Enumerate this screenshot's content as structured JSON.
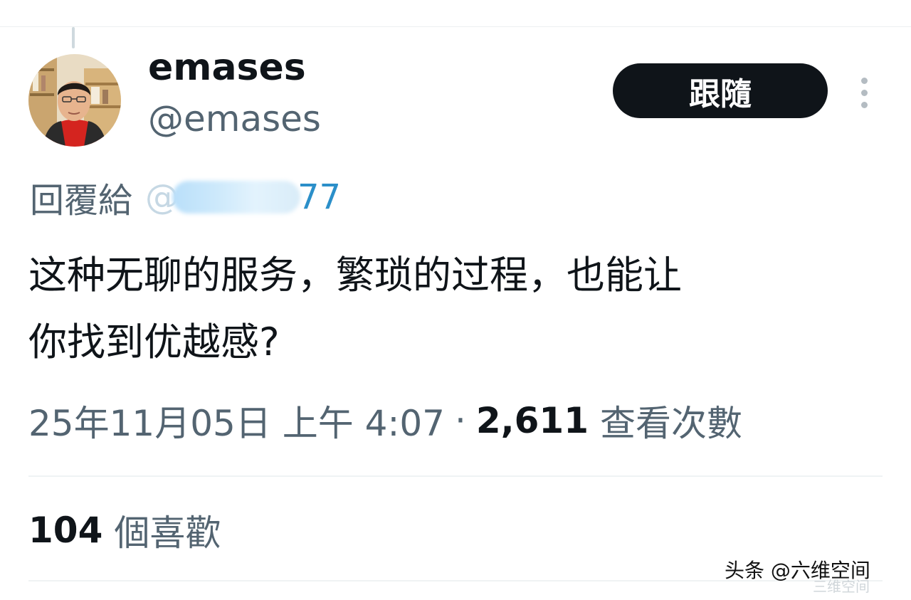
{
  "tweet": {
    "author": {
      "display_name": "emases",
      "handle": "@emases"
    },
    "follow_label": "跟隨",
    "reply_to": {
      "label": "回覆給",
      "mention_prefix": "@",
      "mention_visible_suffix": "77"
    },
    "text_line_1": "这种无聊的服务，繁琐的过程，也能让",
    "text_line_2": "你找到优越感?",
    "timestamp": "25年11月05日 上午 4:07",
    "separator": "·",
    "views_count": "2,611",
    "views_label": "查看次數",
    "likes_count": "104",
    "likes_label": "個喜歡"
  },
  "watermark": {
    "text": "头条 @六维空间",
    "ghost_text": "三维空间"
  },
  "icons": {
    "more": "more-vertical-icon",
    "avatar": "user-avatar-photo"
  },
  "colors": {
    "text_primary": "#0f1419",
    "text_secondary": "#536471",
    "link": "#1d9bf0",
    "follow_bg": "#0f1419",
    "divider": "#eff3f4"
  }
}
